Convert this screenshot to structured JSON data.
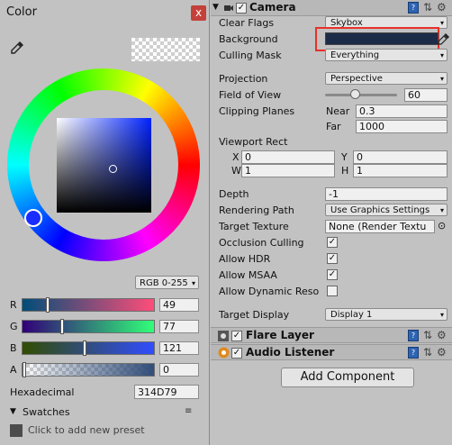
{
  "color_window": {
    "title": "Color",
    "close_label": "x",
    "mode": "RGB 0-255",
    "channels": [
      {
        "label": "R",
        "value": "49",
        "fraction": 0.19,
        "gradient": [
          "#004d79",
          "#ff4d79"
        ]
      },
      {
        "label": "G",
        "value": "77",
        "fraction": 0.3,
        "gradient": [
          "#310079",
          "#31ff79"
        ]
      },
      {
        "label": "B",
        "value": "121",
        "fraction": 0.47,
        "gradient": [
          "#314d00",
          "#314dff"
        ]
      },
      {
        "label": "A",
        "value": "0",
        "fraction": 0.0,
        "gradient": [
          "#314d79",
          "#314d79"
        ]
      }
    ],
    "hex_label": "Hexadecimal",
    "hex_value": "314D79",
    "swatches_label": "Swatches",
    "swatches_menu": "≡",
    "preset_text": "Click to add new preset",
    "current_color": "#314d79"
  },
  "inspector": {
    "camera": {
      "title": "Camera",
      "enabled": true,
      "rows": {
        "clear_flags": {
          "label": "Clear Flags",
          "value": "Skybox"
        },
        "background": {
          "label": "Background",
          "color": "#1c2b48",
          "highlight": "#e8302a"
        },
        "culling_mask": {
          "label": "Culling Mask",
          "value": "Everything"
        },
        "projection": {
          "label": "Projection",
          "value": "Perspective"
        },
        "fov": {
          "label": "Field of View",
          "value": "60"
        },
        "clipping": {
          "label": "Clipping Planes",
          "near_label": "Near",
          "near": "0.3",
          "far_label": "Far",
          "far": "1000"
        },
        "viewport": {
          "label": "Viewport Rect",
          "x_label": "X",
          "x": "0",
          "y_label": "Y",
          "y": "0",
          "w_label": "W",
          "w": "1",
          "h_label": "H",
          "h": "1"
        },
        "depth": {
          "label": "Depth",
          "value": "-1"
        },
        "rendering_path": {
          "label": "Rendering Path",
          "value": "Use Graphics Settings"
        },
        "target_texture": {
          "label": "Target Texture",
          "value": "None (Render Textu"
        },
        "occlusion": {
          "label": "Occlusion Culling",
          "checked": true
        },
        "hdr": {
          "label": "Allow HDR",
          "checked": true
        },
        "msaa": {
          "label": "Allow MSAA",
          "checked": true
        },
        "dynres": {
          "label": "Allow Dynamic Reso",
          "checked": false
        },
        "target_display": {
          "label": "Target Display",
          "value": "Display 1"
        }
      }
    },
    "flare_layer": {
      "title": "Flare Layer",
      "enabled": true
    },
    "audio_listener": {
      "title": "Audio Listener",
      "enabled": true
    },
    "add_component": "Add Component"
  }
}
